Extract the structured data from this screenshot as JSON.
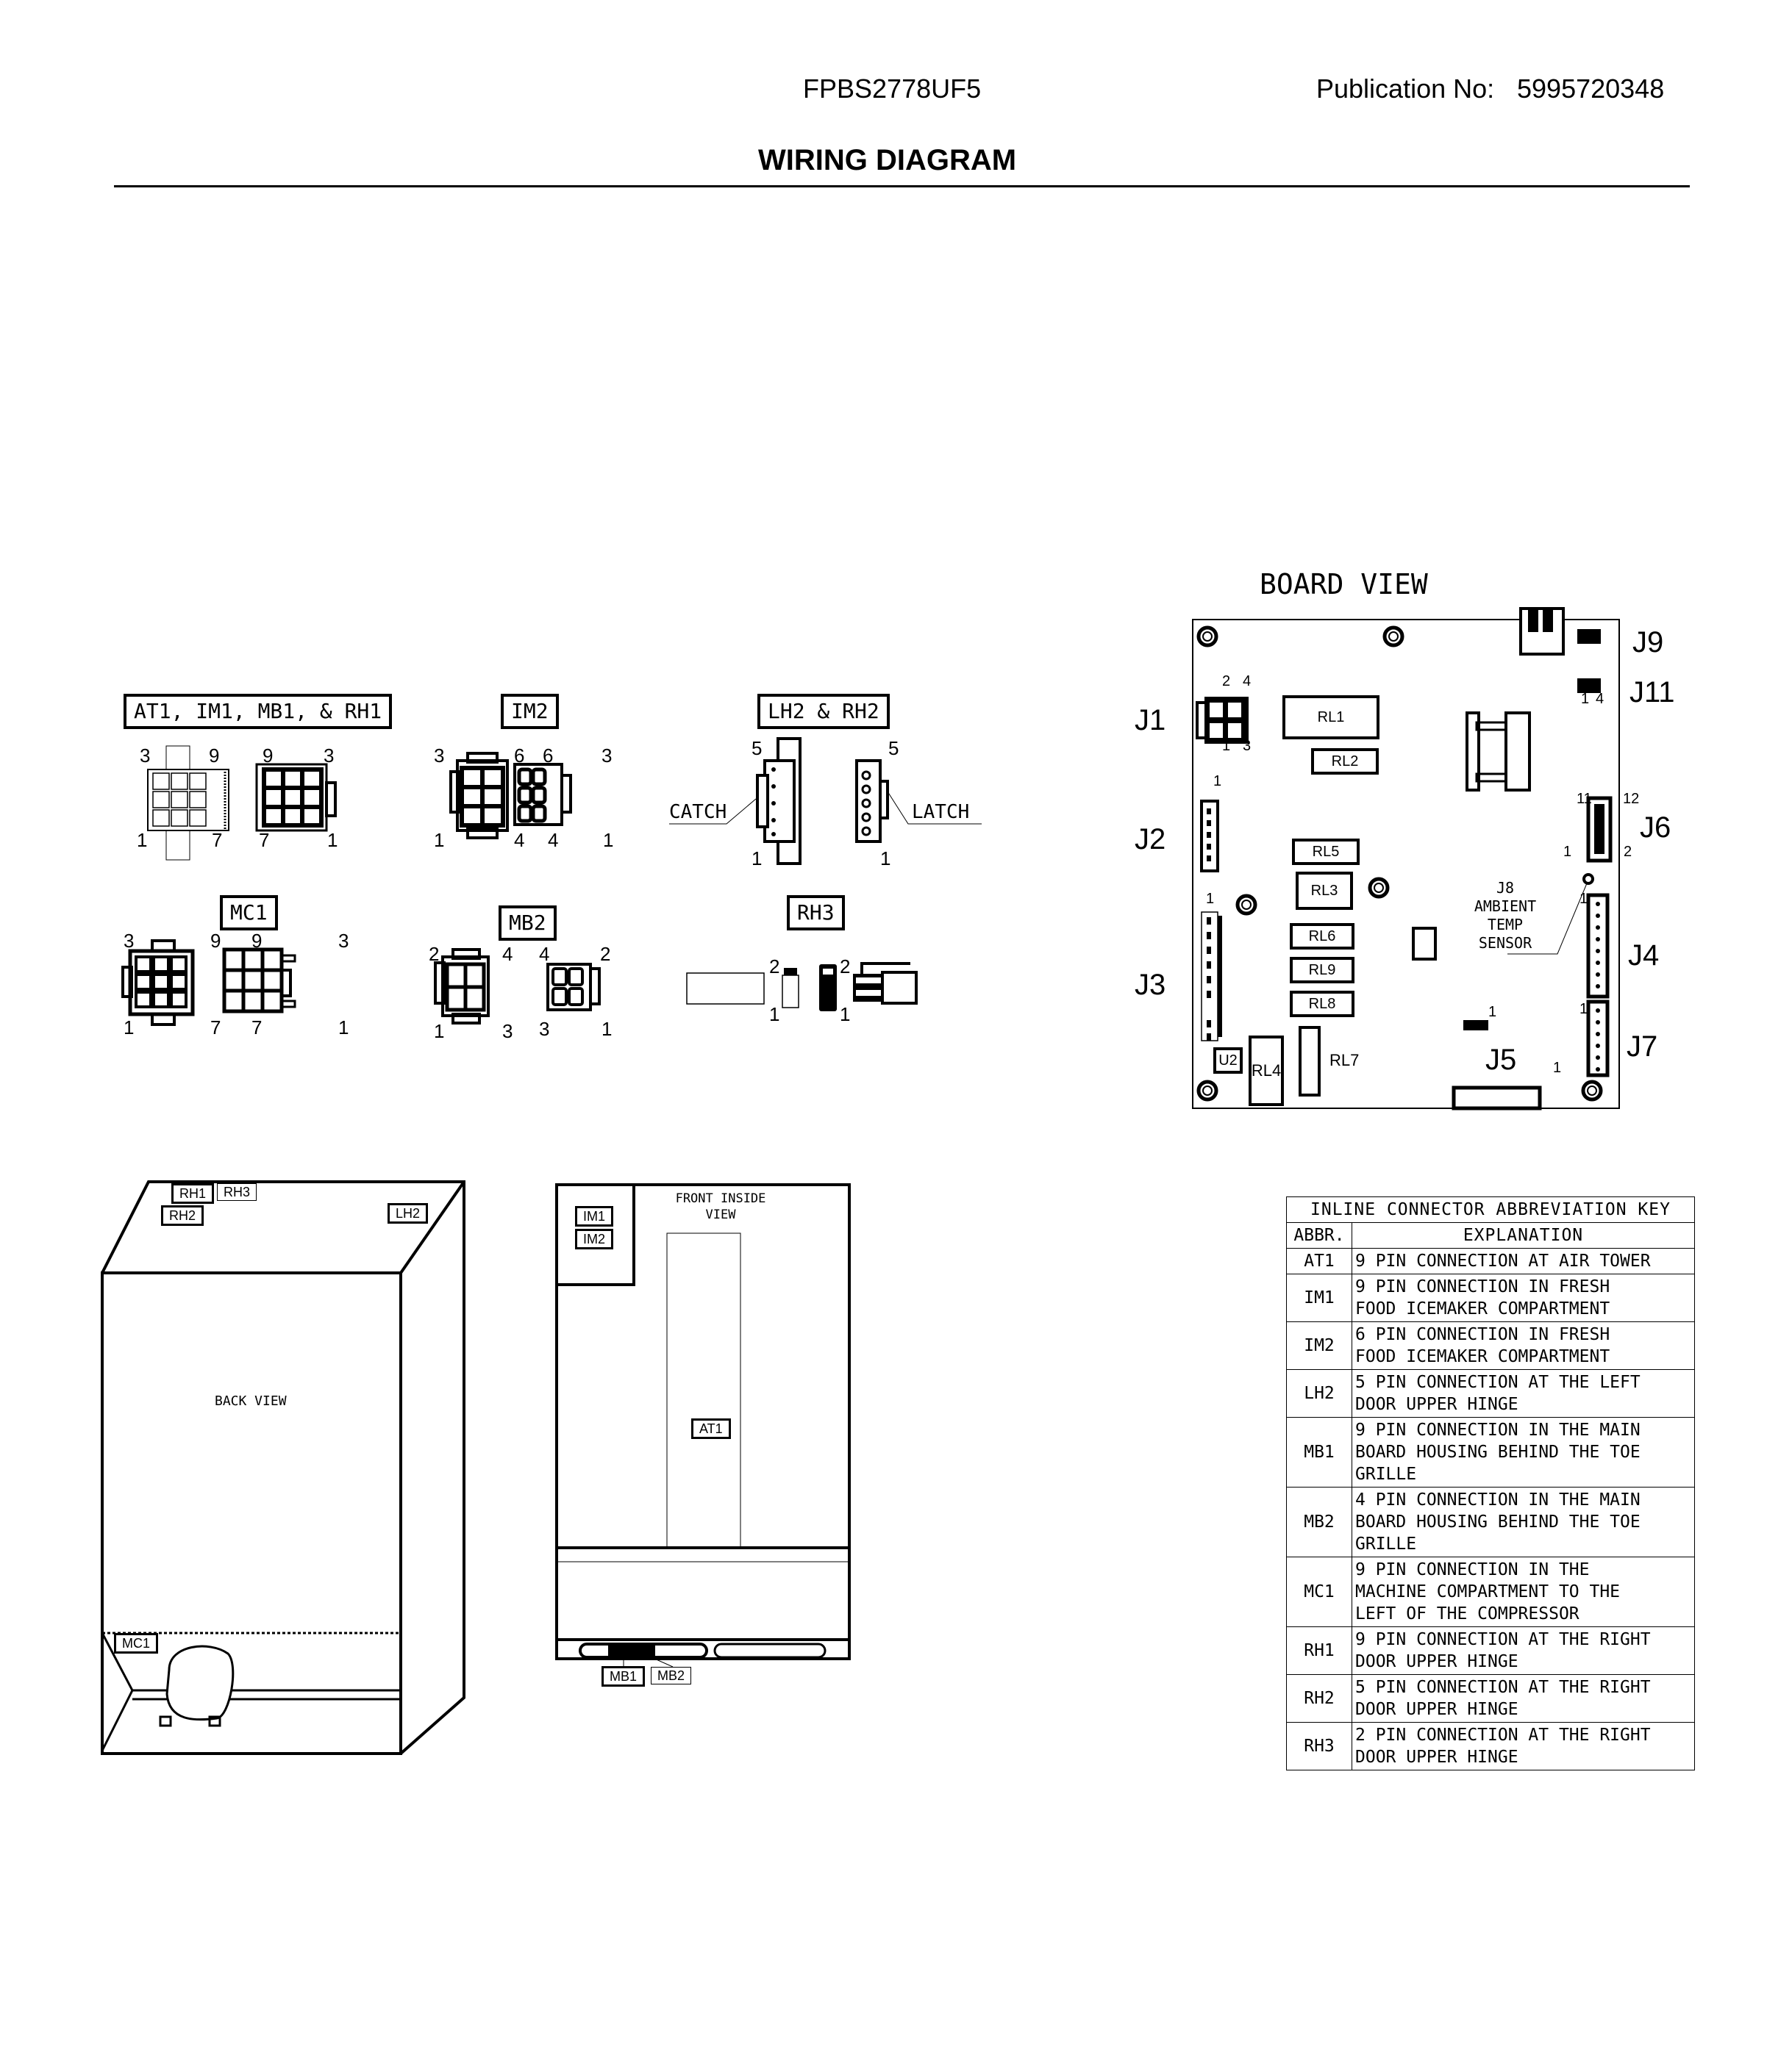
{
  "header": {
    "model": "FPBS2778UF5",
    "publication_label": "Publication No:",
    "publication_number": "5995720348",
    "title": "WIRING DIAGRAM"
  },
  "connectors": {
    "group_at1": {
      "label": "AT1, IM1, MB1, & RH1",
      "pins_left": [
        "3",
        "9",
        "1",
        "7"
      ],
      "pins_right": [
        "9",
        "3",
        "7",
        "1"
      ]
    },
    "group_im2": {
      "label": "IM2",
      "pins_left": [
        "3",
        "6",
        "1",
        "4"
      ],
      "pins_right": [
        "6",
        "3",
        "4",
        "1"
      ]
    },
    "group_lh2": {
      "label": "LH2 & RH2",
      "pins_left": [
        "5",
        "1"
      ],
      "pins_right": [
        "5",
        "1"
      ],
      "catch_label": "CATCH",
      "latch_label": "LATCH"
    },
    "group_mc1": {
      "label": "MC1",
      "pins_left": [
        "3",
        "9",
        "1",
        "7"
      ],
      "pins_right": [
        "9",
        "3",
        "7",
        "1"
      ]
    },
    "group_mb2": {
      "label": "MB2",
      "pins_left": [
        "2",
        "4",
        "1",
        "3"
      ],
      "pins_right": [
        "4",
        "2",
        "3",
        "1"
      ]
    },
    "group_rh3": {
      "label": "RH3",
      "pins_left": [
        "2",
        "1"
      ],
      "pins_right": [
        "2",
        "1"
      ]
    }
  },
  "board": {
    "title": "BOARD VIEW",
    "jacks": [
      "J1",
      "J2",
      "J3",
      "J4",
      "J5",
      "J6",
      "J7",
      "J9",
      "J11"
    ],
    "j1_pins": [
      "2",
      "4",
      "1",
      "3"
    ],
    "j11_pins": [
      "1",
      "4"
    ],
    "j6_pins": [
      "11",
      "12",
      "1",
      "2"
    ],
    "pin_one": "1",
    "relays": [
      "RL1",
      "RL2",
      "RL5",
      "RL3",
      "RL6",
      "RL9",
      "RL8",
      "RL4",
      "RL7"
    ],
    "u2": "U2",
    "j8_label_lines": [
      "J8",
      "AMBIENT",
      "TEMP",
      "SENSOR"
    ]
  },
  "back_view": {
    "label": "BACK VIEW",
    "tags": [
      "RH1",
      "RH3",
      "RH2",
      "LH2",
      "MC1"
    ]
  },
  "front_view": {
    "label_lines": [
      "FRONT INSIDE",
      "VIEW"
    ],
    "tags": [
      "IM1",
      "IM2",
      "AT1",
      "MB1",
      "MB2"
    ]
  },
  "key_table": {
    "title": "INLINE CONNECTOR ABBREVIATION KEY",
    "col_abbr": "ABBR.",
    "col_expl": "EXPLANATION",
    "rows": [
      {
        "abbr": "AT1",
        "expl": "9 PIN CONNECTION AT AIR TOWER"
      },
      {
        "abbr": "IM1",
        "expl": "9 PIN CONNECTION IN FRESH\nFOOD ICEMAKER COMPARTMENT"
      },
      {
        "abbr": "IM2",
        "expl": "6 PIN CONNECTION IN FRESH\nFOOD ICEMAKER COMPARTMENT"
      },
      {
        "abbr": "LH2",
        "expl": "5 PIN CONNECTION AT THE LEFT\nDOOR UPPER HINGE"
      },
      {
        "abbr": "MB1",
        "expl": "9 PIN CONNECTION IN THE MAIN\nBOARD HOUSING BEHIND THE TOE\nGRILLE"
      },
      {
        "abbr": "MB2",
        "expl": "4 PIN CONNECTION IN THE MAIN\nBOARD HOUSING BEHIND THE TOE\nGRILLE"
      },
      {
        "abbr": "MC1",
        "expl": "9 PIN CONNECTION IN THE\nMACHINE COMPARTMENT TO THE\nLEFT OF THE COMPRESSOR"
      },
      {
        "abbr": "RH1",
        "expl": "9 PIN CONNECTION AT THE RIGHT\nDOOR UPPER HINGE"
      },
      {
        "abbr": "RH2",
        "expl": "5 PIN CONNECTION AT THE RIGHT\nDOOR UPPER HINGE"
      },
      {
        "abbr": "RH3",
        "expl": "2 PIN CONNECTION AT THE RIGHT\nDOOR UPPER HINGE"
      }
    ]
  }
}
